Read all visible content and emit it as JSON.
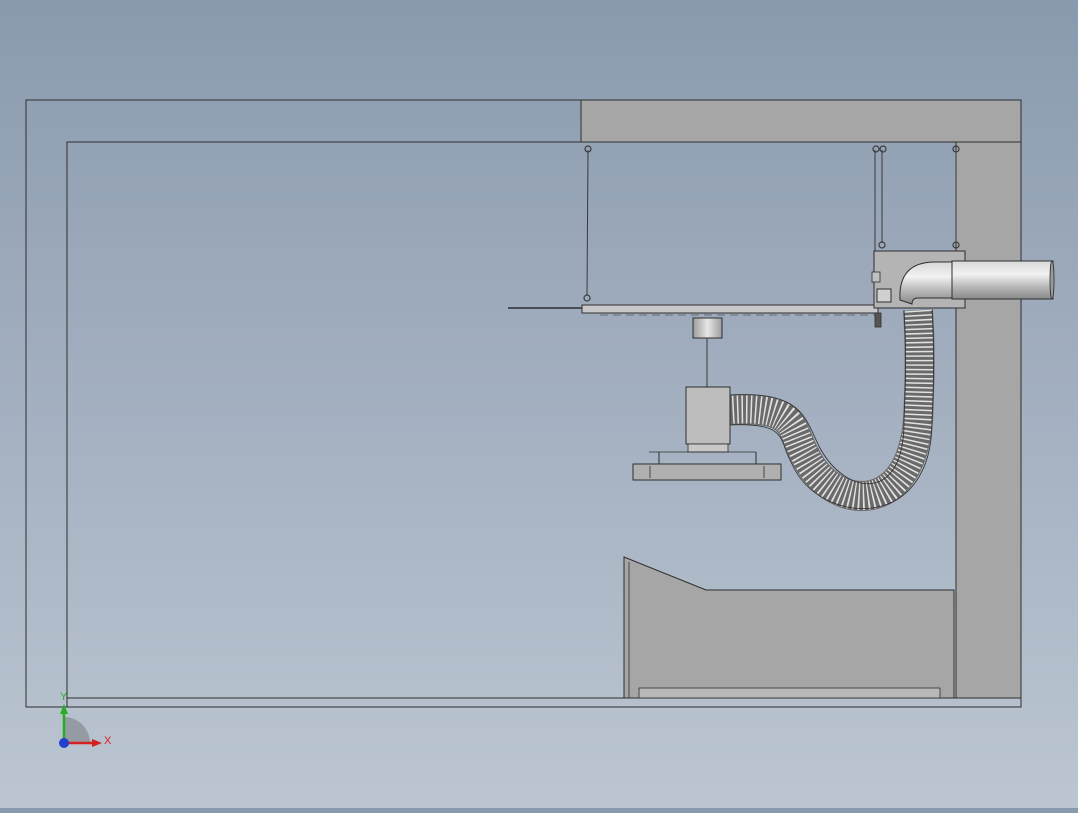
{
  "viewport": {
    "background_top": "#8a9aae",
    "background_bottom": "#bcc6d2"
  },
  "model": {
    "wall_shade": "#a6a6a6",
    "edge_color": "#2e2e2e",
    "hose_color": "#6a6a6a"
  },
  "triad": {
    "x_label": "X",
    "y_label": "Y",
    "x_color": "#d42020",
    "y_color": "#22b022",
    "z_color": "#2040d0"
  }
}
